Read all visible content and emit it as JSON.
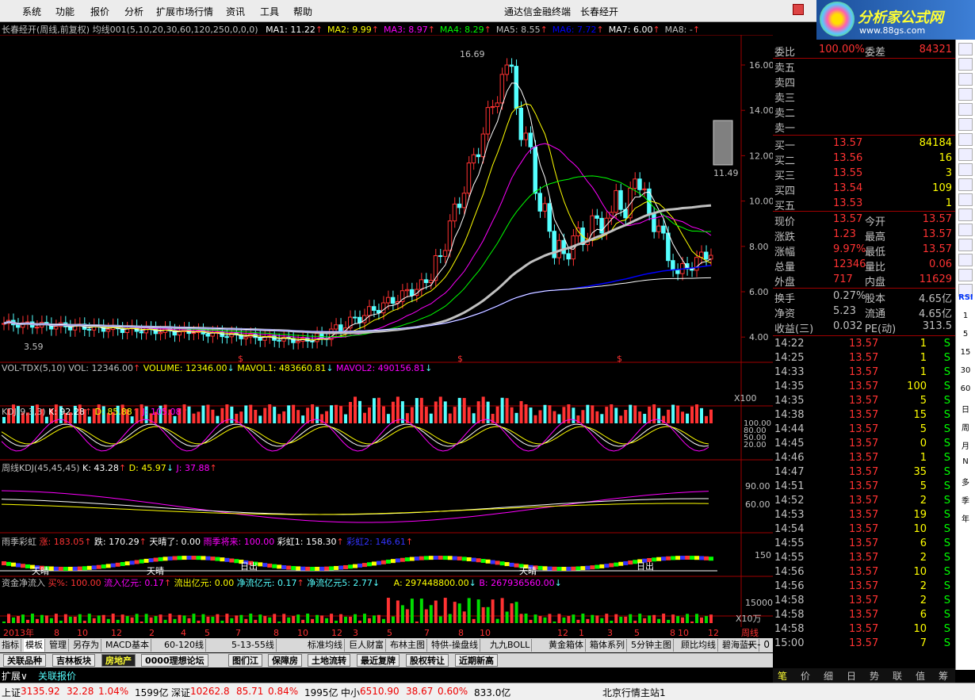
{
  "menu": [
    "系统",
    "功能",
    "报价",
    "分析",
    "扩展市场行情",
    "资讯",
    "工具",
    "帮助"
  ],
  "window_title": "通达信金融终端",
  "stock_name_title": "长春经开",
  "logo": {
    "title": "分析家公式网",
    "url": "www.88gs.com"
  },
  "chart_header": {
    "label": "长春经开(周线,前复权) 均线001(5,10,20,30,60,120,250,0,0,0)",
    "ma": [
      {
        "t": "MA1: 11.22",
        "c": "#ffffff"
      },
      {
        "t": "MA2: 9.99",
        "c": "#ffff00"
      },
      {
        "t": "MA3: 8.97",
        "c": "#ff00ff"
      },
      {
        "t": "MA4: 8.29",
        "c": "#00ff00"
      },
      {
        "t": "MA5: 8.55",
        "c": "#c0c0c0"
      },
      {
        "t": "MA6: 7.72",
        "c": "#0000ff"
      },
      {
        "t": "MA7: 6.00",
        "c": "#ffffff"
      },
      {
        "t": "MA8: -",
        "c": "#c0c0c0"
      }
    ]
  },
  "price_axis": [
    "16.00",
    "14.00",
    "12.00",
    "10.00",
    "8.00",
    "6.00",
    "4.00"
  ],
  "price_marks": {
    "high": "16.69",
    "low": "3.59",
    "last": "11.49"
  },
  "vol_header": {
    "name": "VOL-TDX(5,10)",
    "vol": "VOL: 12346.00",
    "volume": "VOLUME: 12346.00",
    "mavol1": "MAVOL1: 483660.81",
    "mavol2": "MAVOL2: 490156.81"
  },
  "vol_axis": "X100",
  "kdj_header": {
    "name": "KDJ(9,3,3)",
    "k": "K: 92.28",
    "d": "D: 85.88",
    "j": "J: 105.08"
  },
  "kdj_axis": [
    "100.00",
    "80.00",
    "50.00",
    "20.00"
  ],
  "wkdj_header": {
    "name": "周线KDJ(45,45,45)",
    "k": "K: 43.28",
    "d": "D: 45.97",
    "j": "J: 37.88"
  },
  "wkdj_axis": [
    "90.00",
    "60.00"
  ],
  "rain_header": {
    "name": "雨季彩虹",
    "zhang": "涨: 183.05",
    "die": "跌: 170.29",
    "qing": "天晴了: 0.00",
    "yu": "雨季将来: 100.00",
    "cai1": "彩虹1: 158.30",
    "cai2": "彩虹2: 146.61"
  },
  "rain_axis": "150",
  "rain_labels": [
    "天晴",
    "天晴",
    "日出",
    "天晴",
    "日出"
  ],
  "fund_header": {
    "name": "资金净流入",
    "buy": "买%: 100.00",
    "inflow": "流入亿元: 0.17",
    "outflow": "流出亿元: 0.00",
    "net": "净流亿元: 0.17",
    "net5": "净流亿元5: 2.77",
    "a": "A: 297448800.00",
    "b": "B: 267936560.00"
  },
  "fund_axis": [
    "15000",
    "X10万"
  ],
  "time_axis": [
    "2013年",
    "8",
    "10",
    "12",
    "2",
    "4",
    "5",
    "7",
    "8",
    "10",
    "12",
    "3",
    "5",
    "7",
    "8",
    "10",
    "12",
    "1",
    "3",
    "5",
    "8",
    "10",
    "12",
    "周线"
  ],
  "bottom_tabs": [
    "指标",
    "模板",
    "管理",
    "另存为",
    "MACD基本",
    "60-120线",
    "5-13-55线",
    "标准均线",
    "巨人财富",
    "布林主图",
    "特供-操盘线",
    "九九BOLL",
    "黄金箱体",
    "箱体系列",
    "5分钟主图",
    "顾比均线",
    "碧海蓝天"
  ],
  "board_tabs": [
    "关联品种",
    "吉林板块",
    "房地产",
    "0000理想论坛",
    "图们江",
    "保障房",
    "土地流转",
    "最近复牌",
    "股权转让",
    "近期新高"
  ],
  "expand_tabs": [
    "扩展∨",
    "关联报价"
  ],
  "quote": {
    "header": {
      "wb_label": "委比",
      "wb": "100.00%",
      "wc_label": "委差",
      "wc": "84321"
    },
    "sells": [
      "卖五",
      "卖四",
      "卖三",
      "卖二",
      "卖一"
    ],
    "buys": [
      {
        "l": "买一",
        "p": "13.57",
        "v": "84184"
      },
      {
        "l": "买二",
        "p": "13.56",
        "v": "16"
      },
      {
        "l": "买三",
        "p": "13.55",
        "v": "3"
      },
      {
        "l": "买四",
        "p": "13.54",
        "v": "109"
      },
      {
        "l": "买五",
        "p": "13.53",
        "v": "1"
      }
    ],
    "stats": [
      {
        "a": "现价",
        "av": "13.57",
        "b": "今开",
        "bv": "13.57"
      },
      {
        "a": "涨跌",
        "av": "1.23",
        "b": "最高",
        "bv": "13.57"
      },
      {
        "a": "涨幅",
        "av": "9.97%",
        "b": "最低",
        "bv": "13.57"
      },
      {
        "a": "总量",
        "av": "12346",
        "b": "量比",
        "bv": "0.06"
      },
      {
        "a": "外盘",
        "av": "717",
        "b": "内盘",
        "bv": "11629"
      }
    ],
    "stats2": [
      {
        "a": "换手",
        "av": "0.27%",
        "b": "股本",
        "bv": "4.65亿"
      },
      {
        "a": "净资",
        "av": "5.23",
        "b": "流通",
        "bv": "4.65亿"
      },
      {
        "a": "收益(三)",
        "av": "0.032",
        "b": "PE(动)",
        "bv": "313.5"
      }
    ],
    "ticks": [
      {
        "t": "14:22",
        "p": "13.57",
        "v": "1",
        "s": "S"
      },
      {
        "t": "14:25",
        "p": "13.57",
        "v": "1",
        "s": "S"
      },
      {
        "t": "14:33",
        "p": "13.57",
        "v": "1",
        "s": "S"
      },
      {
        "t": "14:35",
        "p": "13.57",
        "v": "100",
        "s": "S"
      },
      {
        "t": "14:35",
        "p": "13.57",
        "v": "5",
        "s": "S"
      },
      {
        "t": "14:38",
        "p": "13.57",
        "v": "15",
        "s": "S"
      },
      {
        "t": "14:44",
        "p": "13.57",
        "v": "5",
        "s": "S"
      },
      {
        "t": "14:45",
        "p": "13.57",
        "v": "0",
        "s": "S"
      },
      {
        "t": "14:46",
        "p": "13.57",
        "v": "1",
        "s": "S"
      },
      {
        "t": "14:47",
        "p": "13.57",
        "v": "35",
        "s": "S"
      },
      {
        "t": "14:51",
        "p": "13.57",
        "v": "5",
        "s": "S"
      },
      {
        "t": "14:52",
        "p": "13.57",
        "v": "2",
        "s": "S"
      },
      {
        "t": "14:53",
        "p": "13.57",
        "v": "19",
        "s": "S"
      },
      {
        "t": "14:54",
        "p": "13.57",
        "v": "10",
        "s": "S"
      },
      {
        "t": "14:55",
        "p": "13.57",
        "v": "6",
        "s": "S"
      },
      {
        "t": "14:55",
        "p": "13.57",
        "v": "2",
        "s": "S"
      },
      {
        "t": "14:56",
        "p": "13.57",
        "v": "10",
        "s": "S"
      },
      {
        "t": "14:56",
        "p": "13.57",
        "v": "2",
        "s": "S"
      },
      {
        "t": "14:58",
        "p": "13.57",
        "v": "2",
        "s": "S"
      },
      {
        "t": "14:58",
        "p": "13.57",
        "v": "6",
        "s": "S"
      },
      {
        "t": "14:58",
        "p": "13.57",
        "v": "10",
        "s": "S"
      },
      {
        "t": "15:00",
        "p": "13.57",
        "v": "7",
        "s": "S"
      }
    ],
    "tabs": [
      "笔",
      "价",
      "细",
      "日",
      "势",
      "联",
      "值",
      "筹"
    ]
  },
  "right_toolbar": [
    "RSI",
    "1",
    "5",
    "15",
    "30",
    "60",
    "日",
    "周",
    "月",
    "N",
    "多",
    "季",
    "年"
  ],
  "status": [
    {
      "n": "上证",
      "v": "3135.92",
      "c": "32.28",
      "p": "1.04%",
      "a": "1599亿"
    },
    {
      "n": "深证",
      "v": "10262.8",
      "c": "85.71",
      "p": "0.84%",
      "a": "1995亿"
    },
    {
      "n": "中小",
      "v": "6510.90",
      "c": "38.67",
      "p": "0.60%",
      "a": "833.0亿"
    }
  ],
  "status_server": "北京行情主站1",
  "colors": {
    "up": "#ff3232",
    "down": "#54ffff",
    "accent": "#ff3232"
  }
}
